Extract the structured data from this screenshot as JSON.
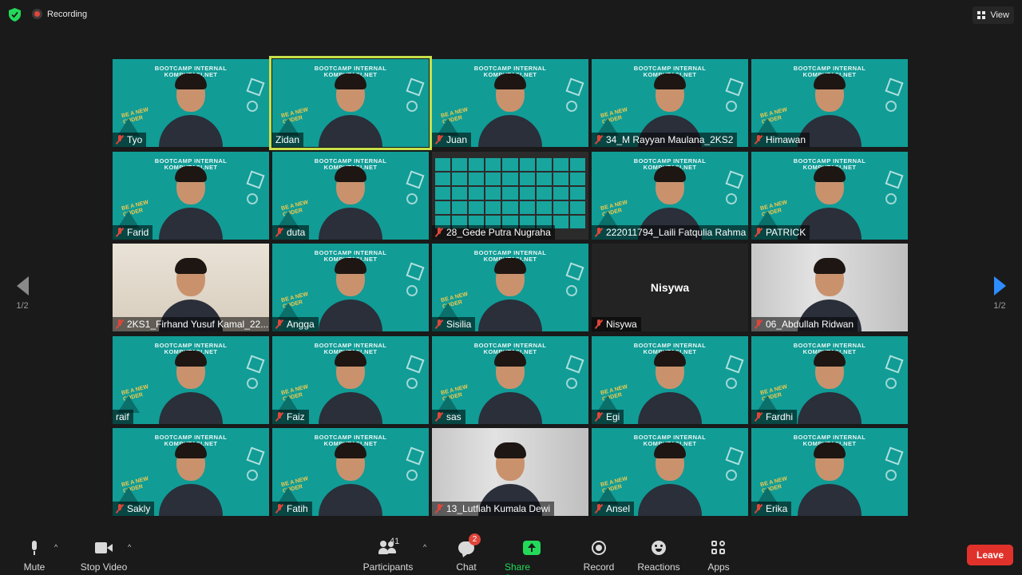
{
  "topbar": {
    "recording_label": "Recording",
    "view_label": "View"
  },
  "pagination": {
    "left_page": "1/2",
    "right_page": "1/2"
  },
  "background": {
    "title_line1": "BOOTCAMP INTERNAL",
    "title_line2": "KOMPUTASI.NET",
    "slogan_line1": "BE A NEW",
    "slogan_line2": "CODER"
  },
  "tiles": [
    {
      "name": "Tyo",
      "muted": true,
      "style": "bootcamp"
    },
    {
      "name": "Zidan",
      "muted": false,
      "style": "bootcamp",
      "active": true
    },
    {
      "name": "Juan",
      "muted": true,
      "style": "bootcamp"
    },
    {
      "name": "34_M Rayyan Maulana_2KS2",
      "muted": true,
      "style": "bootcamp"
    },
    {
      "name": "Himawan",
      "muted": true,
      "style": "bootcamp"
    },
    {
      "name": "Farid",
      "muted": true,
      "style": "bootcamp"
    },
    {
      "name": "duta",
      "muted": true,
      "style": "bootcamp"
    },
    {
      "name": "28_Gede Putra Nugraha",
      "muted": true,
      "style": "gallery"
    },
    {
      "name": "222011794_Laili Fatqulia Rahma",
      "muted": true,
      "style": "bootcamp"
    },
    {
      "name": "PATRICK",
      "muted": true,
      "style": "bootcamp"
    },
    {
      "name": "2KS1_Firhand Yusuf Kamal_22...",
      "muted": true,
      "style": "photo"
    },
    {
      "name": "Angga",
      "muted": true,
      "style": "bootcamp"
    },
    {
      "name": "Sisilia",
      "muted": true,
      "style": "bootcamp"
    },
    {
      "name": "Nisywa",
      "muted": true,
      "style": "dark"
    },
    {
      "name": "06_Abdullah Ridwan",
      "muted": true,
      "style": "room"
    },
    {
      "name": "raif",
      "muted": false,
      "style": "bootcamp"
    },
    {
      "name": "Faiz",
      "muted": true,
      "style": "bootcamp"
    },
    {
      "name": "sas",
      "muted": true,
      "style": "bootcamp"
    },
    {
      "name": "Egi",
      "muted": true,
      "style": "bootcamp"
    },
    {
      "name": "Fardhi",
      "muted": true,
      "style": "bootcamp"
    },
    {
      "name": "Sakly",
      "muted": true,
      "style": "bootcamp"
    },
    {
      "name": "Fatih",
      "muted": true,
      "style": "bootcamp"
    },
    {
      "name": "13_Lutfiah Kumala Dewi",
      "muted": true,
      "style": "room"
    },
    {
      "name": "Ansel",
      "muted": true,
      "style": "bootcamp"
    },
    {
      "name": "Erika",
      "muted": true,
      "style": "bootcamp"
    }
  ],
  "toolbar": {
    "mute_label": "Mute",
    "stop_video_label": "Stop Video",
    "participants_label": "Participants",
    "participants_count": "41",
    "chat_label": "Chat",
    "chat_badge": "2",
    "share_screen_label": "Share Screen",
    "record_label": "Record",
    "reactions_label": "Reactions",
    "apps_label": "Apps",
    "leave_label": "Leave"
  },
  "colors": {
    "tile_teal": "#119c96",
    "active_border": "#c8e04a",
    "share_green": "#23d959",
    "leave_red": "#e0322b",
    "muted_red": "#e0453a",
    "next_arrow": "#2d8cff"
  }
}
